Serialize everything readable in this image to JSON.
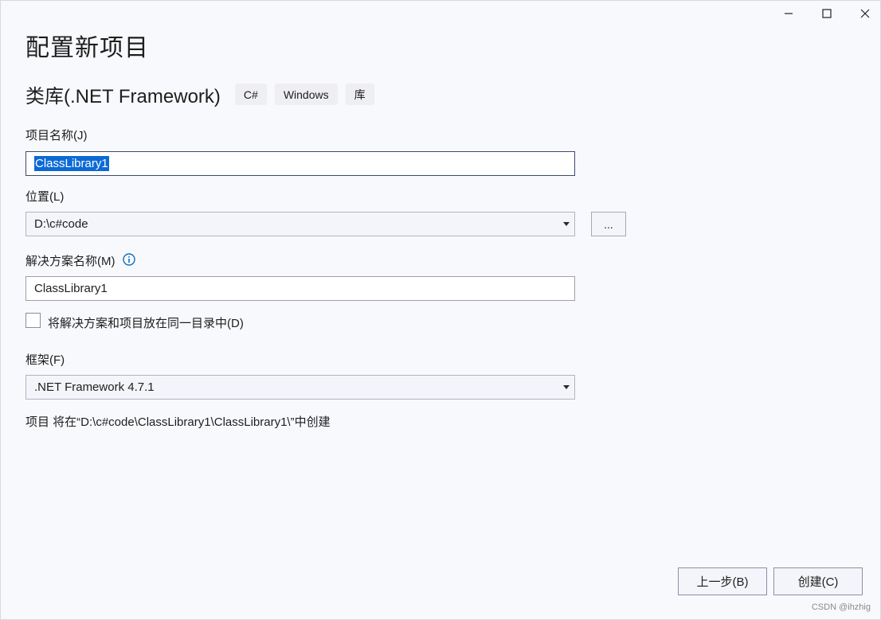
{
  "window": {
    "title": "配置新项目",
    "controls": {
      "minimize": "minimize-icon",
      "maximize": "maximize-icon",
      "close": "close-icon"
    }
  },
  "template": {
    "name": "类库(.NET Framework)",
    "tags": [
      "C#",
      "Windows",
      "库"
    ]
  },
  "project_name": {
    "label": "项目名称(J)",
    "value": "ClassLibrary1"
  },
  "location": {
    "label": "位置(L)",
    "value": "D:\\c#code",
    "browse_label": "..."
  },
  "solution_name": {
    "label": "解决方案名称(M)",
    "value": "ClassLibrary1",
    "info_icon": "info-icon"
  },
  "same_directory": {
    "label": "将解决方案和项目放在同一目录中(D)",
    "checked": false
  },
  "framework": {
    "label": "框架(F)",
    "value": ".NET Framework 4.7.1"
  },
  "path_note": "项目 将在“D:\\c#code\\ClassLibrary1\\ClassLibrary1\\”中创建",
  "buttons": {
    "back": "上一步(B)",
    "create": "创建(C)"
  },
  "watermark": "CSDN @ihzhig",
  "colors": {
    "selection": "#0c6ad6",
    "info": "#0e70c0",
    "background": "#f8f9fc"
  }
}
